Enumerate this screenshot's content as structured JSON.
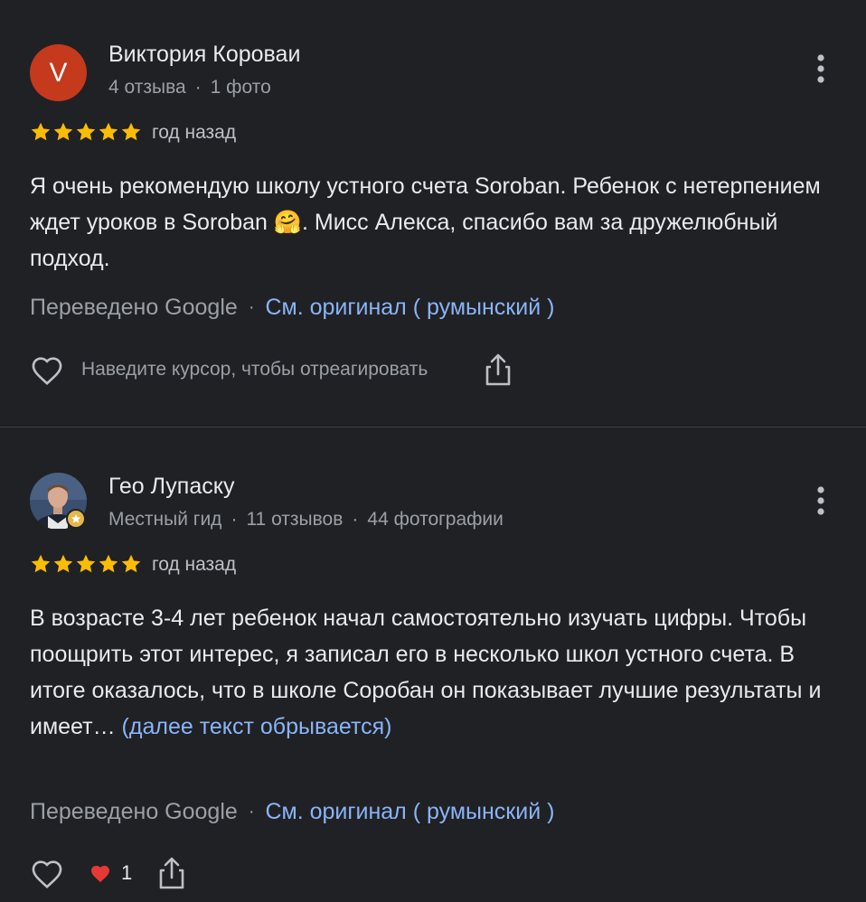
{
  "colors": {
    "background": "#202124",
    "star": "#fbbc04",
    "link": "#8ab4f8",
    "secondary_text": "#9aa0a6",
    "avatar_letter_bg": "#c5391c",
    "heart": "#e53935"
  },
  "reviews": [
    {
      "author": "Виктория Короваи",
      "avatar_letter": "V",
      "meta_reviews": "4 отзыва",
      "meta_separator": "·",
      "meta_photos": "1 фото",
      "rating": 5,
      "date": "год назад",
      "text": "Я очень рекомендую школу устного счета Soroban. Ребенок с нетерпением ждет уроков в Soroban 🤗. Мисс Алекса, спасибо вам за дружелюбный подход.",
      "translated_by": "Переведено Google",
      "translated_separator": "·",
      "see_original": "См. оригинал ( румынский )",
      "reaction_hint": "Наведите курсор, чтобы отреагировать",
      "icons": {
        "more": "more-vert-icon",
        "like": "heart-outline-icon",
        "share": "share-icon"
      }
    },
    {
      "author": "Гео Лупаску",
      "meta_badge": "Местный гид",
      "meta_separator": "·",
      "meta_reviews": "11 отзывов",
      "meta_photos": "44 фотографии",
      "rating": 5,
      "date": "год назад",
      "text": "В возрасте 3-4 лет ребенок начал самостоятельно изучать цифры. Чтобы поощрить этот интерес, я записал его в несколько школ устного счета. В итоге оказалось, что в школе Соробан он показывает лучшие результаты и имеет…",
      "more_link": "(далее текст обрывается)",
      "translated_by": "Переведено Google",
      "translated_separator": "·",
      "see_original": "См. оригинал ( румынский )",
      "reaction_emoji": "❤️",
      "reaction_count": "1",
      "icons": {
        "more": "more-vert-icon",
        "like": "heart-outline-icon",
        "share": "share-icon",
        "badge": "local-guide-star-icon"
      }
    }
  ]
}
